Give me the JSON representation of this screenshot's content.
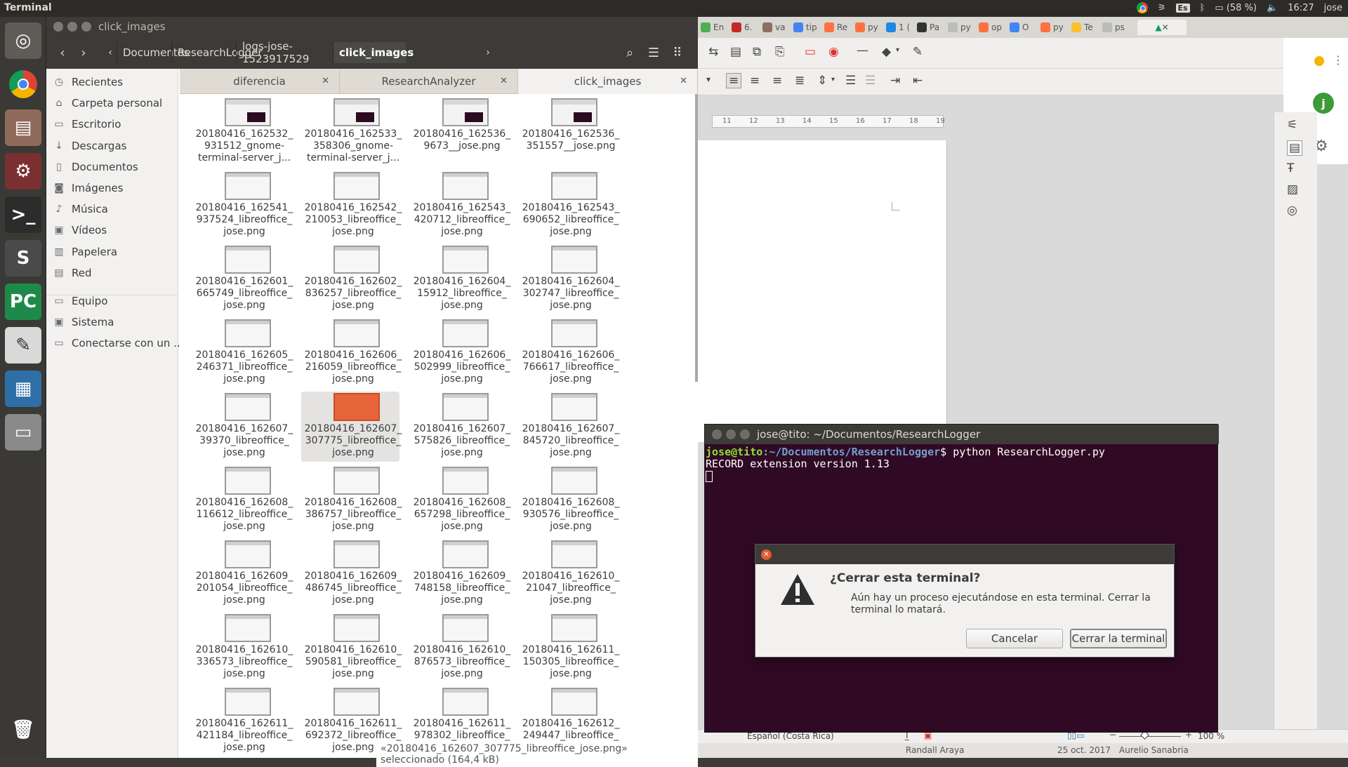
{
  "top_panel": {
    "app_title": "Terminal",
    "keyboard": "Es",
    "battery": "(58 %)",
    "time": "16:27",
    "user": "jose"
  },
  "launcher": {
    "items": [
      {
        "name": "ubuntu-dash-icon",
        "glyph": "◎",
        "color": "#5e5c57"
      },
      {
        "name": "chrome-launcher-icon",
        "glyph": "",
        "color": "#3a3935"
      },
      {
        "name": "files-launcher-icon",
        "glyph": "▤",
        "color": "#8e6a5b"
      },
      {
        "name": "settings-launcher-icon",
        "glyph": "⚙",
        "color": "#7a3030"
      },
      {
        "name": "terminal-launcher-icon",
        "glyph": ">_",
        "color": "#2c2c2c"
      },
      {
        "name": "sublime-launcher-icon",
        "glyph": "S",
        "color": "#4a4a4a"
      },
      {
        "name": "pycharm-launcher-icon",
        "glyph": "PC",
        "color": "#1e8a4a"
      },
      {
        "name": "text-editor-launcher-icon",
        "glyph": "✎",
        "color": "#d9d9d9"
      },
      {
        "name": "impress-launcher-icon",
        "glyph": "▦",
        "color": "#2f6fa8"
      },
      {
        "name": "drive-launcher-icon",
        "glyph": "▭",
        "color": "#8a8a8a"
      },
      {
        "name": "trash-launcher-icon",
        "glyph": "🗑",
        "color": "#3a3935"
      }
    ]
  },
  "file_manager": {
    "window_title": "click_images",
    "breadcrumbs": [
      "Documentos",
      "ResearchLogger",
      "logs-jose-1523917529",
      "click_images"
    ],
    "sidebar": [
      {
        "icon": "clock-icon",
        "glyph": "◷",
        "label": "Recientes"
      },
      {
        "icon": "home-icon",
        "glyph": "⌂",
        "label": "Carpeta personal"
      },
      {
        "icon": "desktop-icon",
        "glyph": "▭",
        "label": "Escritorio"
      },
      {
        "icon": "download-icon",
        "glyph": "↓",
        "label": "Descargas"
      },
      {
        "icon": "document-icon",
        "glyph": "▯",
        "label": "Documentos"
      },
      {
        "icon": "image-icon",
        "glyph": "◙",
        "label": "Imágenes"
      },
      {
        "icon": "music-icon",
        "glyph": "♪",
        "label": "Música"
      },
      {
        "icon": "video-icon",
        "glyph": "▣",
        "label": "Vídeos"
      },
      {
        "icon": "trash-icon",
        "glyph": "▥",
        "label": "Papelera"
      },
      {
        "icon": "network-icon",
        "glyph": "▤",
        "label": "Red"
      },
      {
        "icon": "computer-icon",
        "glyph": "▭",
        "label": "Equipo"
      },
      {
        "icon": "system-icon",
        "glyph": "▣",
        "label": "Sistema"
      },
      {
        "icon": "server-icon",
        "glyph": "▭",
        "label": "Conectarse con un ..."
      }
    ],
    "tabs": [
      "diferencia",
      "ResearchAnalyzer",
      "click_images"
    ],
    "files": [
      [
        "20180416_162532_",
        "931512_gnome-",
        "terminal-server_j..."
      ],
      [
        "20180416_162533_",
        "358306_gnome-",
        "terminal-server_j..."
      ],
      [
        "20180416_162536_",
        "9673__jose.png",
        ""
      ],
      [
        "20180416_162536_",
        "351557__jose.png",
        ""
      ],
      [
        "20180416_162541_",
        "937524_libreoffice_",
        "jose.png"
      ],
      [
        "20180416_162542_",
        "210053_libreoffice_",
        "jose.png"
      ],
      [
        "20180416_162543_",
        "420712_libreoffice_",
        "jose.png"
      ],
      [
        "20180416_162543_",
        "690652_libreoffice_",
        "jose.png"
      ],
      [
        "20180416_162601_",
        "665749_libreoffice_",
        "jose.png"
      ],
      [
        "20180416_162602_",
        "836257_libreoffice_",
        "jose.png"
      ],
      [
        "20180416_162604_",
        "15912_libreoffice_",
        "jose.png"
      ],
      [
        "20180416_162604_",
        "302747_libreoffice_",
        "jose.png"
      ],
      [
        "20180416_162605_",
        "246371_libreoffice_",
        "jose.png"
      ],
      [
        "20180416_162606_",
        "216059_libreoffice_",
        "jose.png"
      ],
      [
        "20180416_162606_",
        "502999_libreoffice_",
        "jose.png"
      ],
      [
        "20180416_162606_",
        "766617_libreoffice_",
        "jose.png"
      ],
      [
        "20180416_162607_",
        "39370_libreoffice_",
        "jose.png"
      ],
      [
        "20180416_162607_",
        "307775_libreoffice_",
        "jose.png"
      ],
      [
        "20180416_162607_",
        "575826_libreoffice_",
        "jose.png"
      ],
      [
        "20180416_162607_",
        "845720_libreoffice_",
        "jose.png"
      ],
      [
        "20180416_162608_",
        "116612_libreoffice_",
        "jose.png"
      ],
      [
        "20180416_162608_",
        "386757_libreoffice_",
        "jose.png"
      ],
      [
        "20180416_162608_",
        "657298_libreoffice_",
        "jose.png"
      ],
      [
        "20180416_162608_",
        "930576_libreoffice_",
        "jose.png"
      ],
      [
        "20180416_162609_",
        "201054_libreoffice_",
        "jose.png"
      ],
      [
        "20180416_162609_",
        "486745_libreoffice_",
        "jose.png"
      ],
      [
        "20180416_162609_",
        "748158_libreoffice_",
        "jose.png"
      ],
      [
        "20180416_162610_",
        "21047_libreoffice_",
        "jose.png"
      ],
      [
        "20180416_162610_",
        "336573_libreoffice_",
        "jose.png"
      ],
      [
        "20180416_162610_",
        "590581_libreoffice_",
        "jose.png"
      ],
      [
        "20180416_162610_",
        "876573_libreoffice_",
        "jose.png"
      ],
      [
        "20180416_162611_",
        "150305_libreoffice_",
        "jose.png"
      ],
      [
        "20180416_162611_",
        "421184_libreoffice_",
        "jose.png"
      ],
      [
        "20180416_162611_",
        "692372_libreoffice_",
        "jose.png"
      ],
      [
        "20180416_162611_",
        "978302_libreoffice_",
        "jose.png"
      ],
      [
        "20180416_162612_",
        "249447_libreoffice_",
        "jose.png"
      ]
    ],
    "selected_index": 17,
    "status": "«20180416_162607_307775_libreoffice_jose.png» seleccionado  (164,4 kB)"
  },
  "browser_tabs": [
    "En",
    "6.",
    "va",
    "tip",
    "Re",
    "py",
    "1 (",
    "Pa",
    "py",
    "op",
    "O",
    "py",
    "Te",
    "ps"
  ],
  "writer": {
    "ruler_ticks": [
      "11",
      "12",
      "13",
      "14",
      "15",
      "16",
      "17",
      "18",
      "19"
    ],
    "avatar_letter": "j",
    "language": "Español (Costa Rica)",
    "zoom": "100 %",
    "footer_author": "Randall Araya",
    "footer_date": "25 oct. 2017",
    "footer_author2": "Aurelio Sanabria"
  },
  "terminal": {
    "title": "jose@tito: ~/Documentos/ResearchLogger",
    "prompt_user": "jose@tito",
    "prompt_sep": ":",
    "prompt_path": "~/Documentos/ResearchLogger",
    "command": "$ python ResearchLogger.py",
    "output": "RECORD extension version 1.13"
  },
  "dialog": {
    "title": "¿Cerrar esta terminal?",
    "message": "Aún hay un proceso ejecutándose en esta terminal. Cerrar la terminal lo matará.",
    "cancel": "Cancelar",
    "confirm": "Cerrar la terminal"
  }
}
